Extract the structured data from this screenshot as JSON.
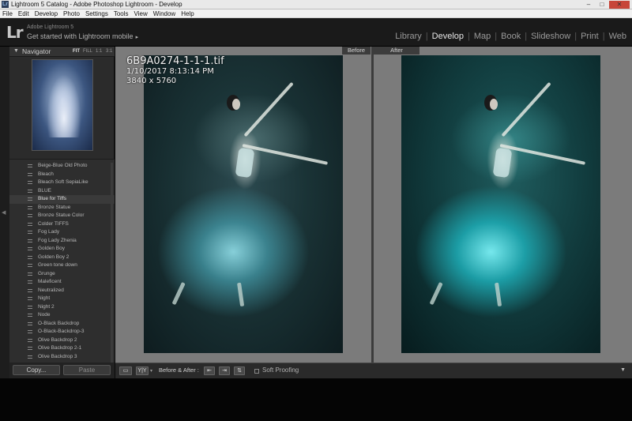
{
  "window": {
    "title": "Lightroom 5 Catalog - Adobe Photoshop Lightroom - Develop",
    "app_icon": "Lr",
    "controls": {
      "minimize": "–",
      "maximize": "□",
      "close": "✕"
    }
  },
  "menu": [
    "File",
    "Edit",
    "Develop",
    "Photo",
    "Settings",
    "Tools",
    "View",
    "Window",
    "Help"
  ],
  "identity": {
    "logo": "Lr",
    "small": "Adobe Lightroom 5",
    "main": "Get started with Lightroom mobile",
    "arrow": "▸"
  },
  "modules": {
    "library": "Library",
    "develop": "Develop",
    "map": "Map",
    "book": "Book",
    "slideshow": "Slideshow",
    "print": "Print",
    "web": "Web",
    "sep": "|"
  },
  "navigator": {
    "label": "Navigator",
    "triangle": "▼",
    "zoom": {
      "fit": "FIT",
      "fill": "FILL",
      "one": "1:1",
      "three": "3:1"
    }
  },
  "presets": [
    "Beige-Blue Old Photo",
    "Bleach",
    "Bleach Soft SepiaLike",
    "BLUE",
    "Blue for Tiffs",
    "Bronze Statue",
    "Bronze Statue Color",
    "Colder TIFFS",
    "Fog Lady",
    "Fog Lady Zhenia",
    "Golden Boy",
    "Golden Boy 2",
    "Green tone down",
    "Grunge",
    "Maleficent",
    "Neutralized",
    "Night",
    "Night 2",
    "Node",
    "O-Black Backdrop",
    "O-Black-Backdrop-3",
    "Olive Backdrop 2",
    "Olive Backdrop 2-1",
    "Olive Backdrop 3"
  ],
  "selected_preset": "Blue for Tiffs",
  "buttons": {
    "copy": "Copy...",
    "paste": "Paste"
  },
  "panes": {
    "before": "Before",
    "after": "After"
  },
  "info": {
    "filename": "6B9A0274-1-1-1.tif",
    "datetime": "1/10/2017 8:13:14 PM",
    "dimensions": "3840 x 5760"
  },
  "toolbar": {
    "loupe": "▭",
    "yy": "Y|Y",
    "caret": "▾",
    "before_after": "Before & After :",
    "copy_left": "⇤",
    "copy_right": "⇥",
    "swap": "⇅",
    "soft_proofing": "Soft Proofing",
    "menu": "▼"
  },
  "left_strip": {
    "collapse": "◀"
  }
}
